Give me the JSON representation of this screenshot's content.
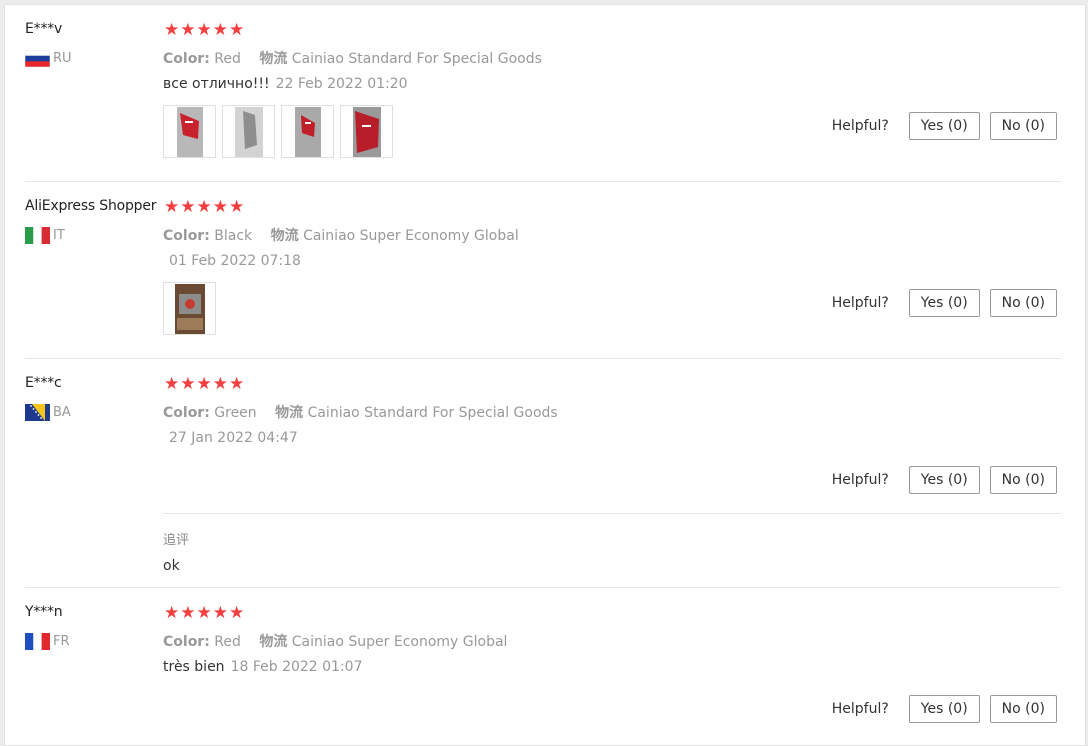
{
  "reviews": [
    {
      "user": "E***v",
      "country": "RU",
      "color_label": "Color:",
      "color_value": "Red",
      "shipping_label": "物流",
      "shipping_value": "Cainiao Standard For Special Goods",
      "text": "все отлично!!!",
      "date": "22 Feb 2022 01:20",
      "rating": 5,
      "helpful_label": "Helpful?",
      "yes_label": "Yes (0)",
      "no_label": "No (0)"
    },
    {
      "user": "AliExpress Shopper",
      "country": "IT",
      "color_label": "Color:",
      "color_value": "Black",
      "shipping_label": "物流",
      "shipping_value": "Cainiao Super Economy Global",
      "text": "",
      "date": "01 Feb 2022 07:18",
      "rating": 5,
      "helpful_label": "Helpful?",
      "yes_label": "Yes (0)",
      "no_label": "No (0)"
    },
    {
      "user": "E***c",
      "country": "BA",
      "color_label": "Color:",
      "color_value": "Green",
      "shipping_label": "物流",
      "shipping_value": "Cainiao Standard For Special Goods",
      "text": "",
      "date": "27 Jan 2022 04:47",
      "rating": 5,
      "helpful_label": "Helpful?",
      "yes_label": "Yes (0)",
      "no_label": "No (0)",
      "followup_title": "追评",
      "followup_text": "ok"
    },
    {
      "user": "Y***n",
      "country": "FR",
      "color_label": "Color:",
      "color_value": "Red",
      "shipping_label": "物流",
      "shipping_value": "Cainiao Super Economy Global",
      "text": "très bien",
      "date": "18 Feb 2022 01:07",
      "rating": 5,
      "helpful_label": "Helpful?",
      "yes_label": "Yes (0)",
      "no_label": "No (0)"
    }
  ],
  "colors": {
    "star": "#f23f3f",
    "muted": "#999999"
  }
}
